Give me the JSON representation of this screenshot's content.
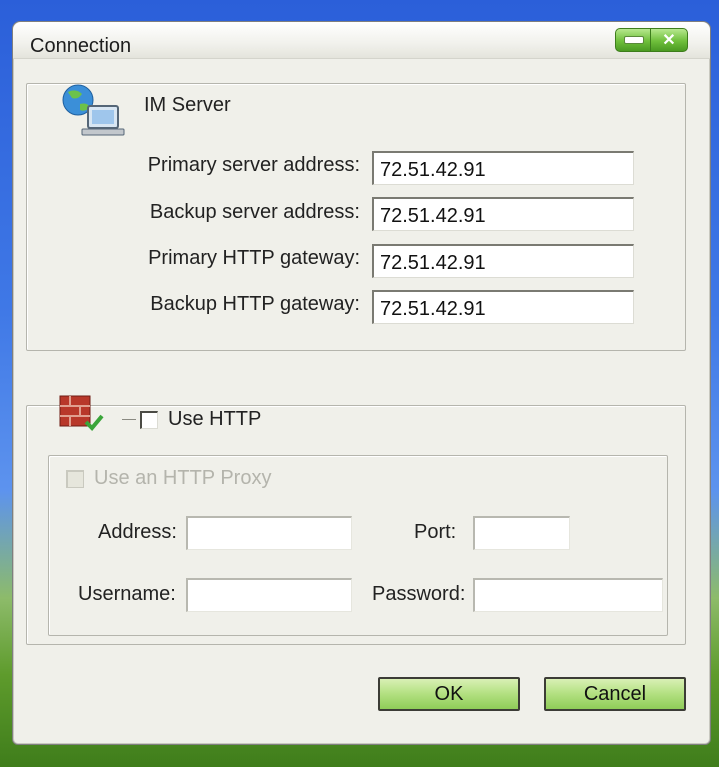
{
  "window": {
    "title": "Connection",
    "minimize_glyph": "–",
    "close_glyph": "✕"
  },
  "im_server": {
    "group_label": "IM Server",
    "icon": "network-computer-icon",
    "rows": [
      {
        "label": "Primary server address:",
        "value": "72.51.42.91"
      },
      {
        "label": "Backup server address:",
        "value": "72.51.42.91"
      },
      {
        "label": "Primary HTTP gateway:",
        "value": "72.51.42.91"
      },
      {
        "label": "Backup HTTP gateway:",
        "value": "72.51.42.91"
      }
    ]
  },
  "http": {
    "icon": "firewall-icon",
    "use_http_label": "Use HTTP",
    "use_http_checked": false,
    "proxy": {
      "use_proxy_label": "Use an HTTP Proxy",
      "use_proxy_checked": false,
      "enabled": false,
      "address_label": "Address:",
      "address_value": "",
      "port_label": "Port:",
      "port_value": "",
      "username_label": "Username:",
      "username_value": "",
      "password_label": "Password:",
      "password_value": ""
    }
  },
  "buttons": {
    "ok": "OK",
    "cancel": "Cancel"
  }
}
